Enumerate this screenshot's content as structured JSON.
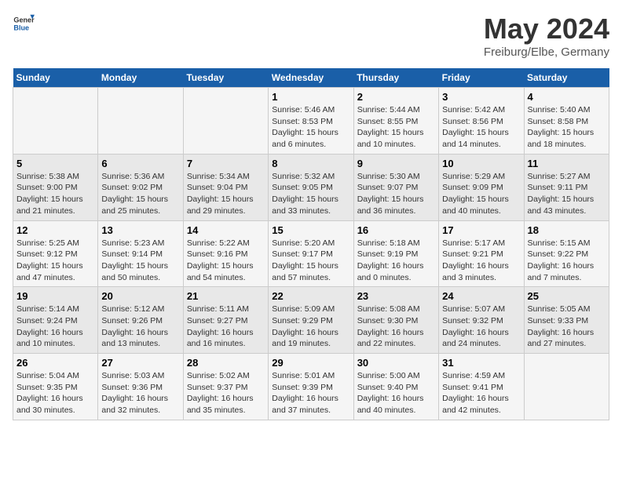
{
  "header": {
    "logo_general": "General",
    "logo_blue": "Blue",
    "month": "May 2024",
    "location": "Freiburg/Elbe, Germany"
  },
  "weekdays": [
    "Sunday",
    "Monday",
    "Tuesday",
    "Wednesday",
    "Thursday",
    "Friday",
    "Saturday"
  ],
  "weeks": [
    [
      {
        "day": "",
        "info": ""
      },
      {
        "day": "",
        "info": ""
      },
      {
        "day": "",
        "info": ""
      },
      {
        "day": "1",
        "info": "Sunrise: 5:46 AM\nSunset: 8:53 PM\nDaylight: 15 hours\nand 6 minutes."
      },
      {
        "day": "2",
        "info": "Sunrise: 5:44 AM\nSunset: 8:55 PM\nDaylight: 15 hours\nand 10 minutes."
      },
      {
        "day": "3",
        "info": "Sunrise: 5:42 AM\nSunset: 8:56 PM\nDaylight: 15 hours\nand 14 minutes."
      },
      {
        "day": "4",
        "info": "Sunrise: 5:40 AM\nSunset: 8:58 PM\nDaylight: 15 hours\nand 18 minutes."
      }
    ],
    [
      {
        "day": "5",
        "info": "Sunrise: 5:38 AM\nSunset: 9:00 PM\nDaylight: 15 hours\nand 21 minutes."
      },
      {
        "day": "6",
        "info": "Sunrise: 5:36 AM\nSunset: 9:02 PM\nDaylight: 15 hours\nand 25 minutes."
      },
      {
        "day": "7",
        "info": "Sunrise: 5:34 AM\nSunset: 9:04 PM\nDaylight: 15 hours\nand 29 minutes."
      },
      {
        "day": "8",
        "info": "Sunrise: 5:32 AM\nSunset: 9:05 PM\nDaylight: 15 hours\nand 33 minutes."
      },
      {
        "day": "9",
        "info": "Sunrise: 5:30 AM\nSunset: 9:07 PM\nDaylight: 15 hours\nand 36 minutes."
      },
      {
        "day": "10",
        "info": "Sunrise: 5:29 AM\nSunset: 9:09 PM\nDaylight: 15 hours\nand 40 minutes."
      },
      {
        "day": "11",
        "info": "Sunrise: 5:27 AM\nSunset: 9:11 PM\nDaylight: 15 hours\nand 43 minutes."
      }
    ],
    [
      {
        "day": "12",
        "info": "Sunrise: 5:25 AM\nSunset: 9:12 PM\nDaylight: 15 hours\nand 47 minutes."
      },
      {
        "day": "13",
        "info": "Sunrise: 5:23 AM\nSunset: 9:14 PM\nDaylight: 15 hours\nand 50 minutes."
      },
      {
        "day": "14",
        "info": "Sunrise: 5:22 AM\nSunset: 9:16 PM\nDaylight: 15 hours\nand 54 minutes."
      },
      {
        "day": "15",
        "info": "Sunrise: 5:20 AM\nSunset: 9:17 PM\nDaylight: 15 hours\nand 57 minutes."
      },
      {
        "day": "16",
        "info": "Sunrise: 5:18 AM\nSunset: 9:19 PM\nDaylight: 16 hours\nand 0 minutes."
      },
      {
        "day": "17",
        "info": "Sunrise: 5:17 AM\nSunset: 9:21 PM\nDaylight: 16 hours\nand 3 minutes."
      },
      {
        "day": "18",
        "info": "Sunrise: 5:15 AM\nSunset: 9:22 PM\nDaylight: 16 hours\nand 7 minutes."
      }
    ],
    [
      {
        "day": "19",
        "info": "Sunrise: 5:14 AM\nSunset: 9:24 PM\nDaylight: 16 hours\nand 10 minutes."
      },
      {
        "day": "20",
        "info": "Sunrise: 5:12 AM\nSunset: 9:26 PM\nDaylight: 16 hours\nand 13 minutes."
      },
      {
        "day": "21",
        "info": "Sunrise: 5:11 AM\nSunset: 9:27 PM\nDaylight: 16 hours\nand 16 minutes."
      },
      {
        "day": "22",
        "info": "Sunrise: 5:09 AM\nSunset: 9:29 PM\nDaylight: 16 hours\nand 19 minutes."
      },
      {
        "day": "23",
        "info": "Sunrise: 5:08 AM\nSunset: 9:30 PM\nDaylight: 16 hours\nand 22 minutes."
      },
      {
        "day": "24",
        "info": "Sunrise: 5:07 AM\nSunset: 9:32 PM\nDaylight: 16 hours\nand 24 minutes."
      },
      {
        "day": "25",
        "info": "Sunrise: 5:05 AM\nSunset: 9:33 PM\nDaylight: 16 hours\nand 27 minutes."
      }
    ],
    [
      {
        "day": "26",
        "info": "Sunrise: 5:04 AM\nSunset: 9:35 PM\nDaylight: 16 hours\nand 30 minutes."
      },
      {
        "day": "27",
        "info": "Sunrise: 5:03 AM\nSunset: 9:36 PM\nDaylight: 16 hours\nand 32 minutes."
      },
      {
        "day": "28",
        "info": "Sunrise: 5:02 AM\nSunset: 9:37 PM\nDaylight: 16 hours\nand 35 minutes."
      },
      {
        "day": "29",
        "info": "Sunrise: 5:01 AM\nSunset: 9:39 PM\nDaylight: 16 hours\nand 37 minutes."
      },
      {
        "day": "30",
        "info": "Sunrise: 5:00 AM\nSunset: 9:40 PM\nDaylight: 16 hours\nand 40 minutes."
      },
      {
        "day": "31",
        "info": "Sunrise: 4:59 AM\nSunset: 9:41 PM\nDaylight: 16 hours\nand 42 minutes."
      },
      {
        "day": "",
        "info": ""
      }
    ]
  ]
}
